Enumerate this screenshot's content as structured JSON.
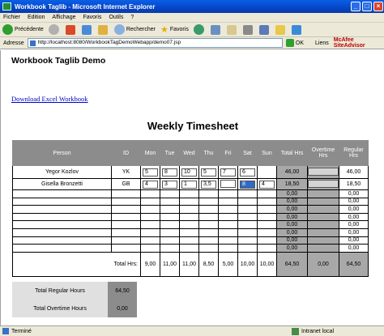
{
  "window": {
    "title": "Workbook Taglib - Microsoft Internet Explorer"
  },
  "menu": [
    "Fichier",
    "Edition",
    "Affichage",
    "Favoris",
    "Outils",
    "?"
  ],
  "toolbar": {
    "back": "Précédente",
    "search": "Rechercher",
    "favorites": "Favoris"
  },
  "address": {
    "label": "Adresse",
    "url": "http://localhost:8080/WorkbookTagDemoWebapp/demo07.jsp",
    "go": "OK",
    "links": "Liens",
    "addon": "McAfee SiteAdvisor"
  },
  "page": {
    "heading": "Workbook Taglib Demo",
    "download_link": "Download Excel Workbook",
    "sheet_title": "Weekly Timesheet"
  },
  "sheet": {
    "headers": [
      "Person",
      "ID",
      "Mon",
      "Tue",
      "Wed",
      "Thu",
      "Fri",
      "Sat",
      "Sun",
      "Total Hrs",
      "Overtime Hrs",
      "Regular Hrs"
    ],
    "rows": [
      {
        "person": "Yegor Kozlov",
        "id": "YK",
        "days": [
          "5",
          "8",
          "10",
          "5",
          "7",
          "6"
        ],
        "total": "46,00",
        "overtime": "",
        "regular": "46,00"
      },
      {
        "person": "Gisella Bronzetti",
        "id": "GB",
        "days": [
          "4",
          "3",
          "1",
          "3,5",
          "",
          "8",
          "4"
        ],
        "total": "18,50",
        "overtime": "",
        "regular": "18,50"
      }
    ],
    "empty_row_value": "0,00",
    "totals": {
      "label": "Total Hrs:",
      "values": [
        "9,00",
        "11,00",
        "11,00",
        "8,50",
        "5,00",
        "10,00",
        "10,00"
      ],
      "total": "64,50",
      "overtime": "0,00",
      "regular": "64,50"
    }
  },
  "summary": [
    {
      "label": "Total Regular Hours",
      "value": "64,50"
    },
    {
      "label": "Total Overtime Hours",
      "value": "0,00"
    }
  ],
  "status": {
    "left": "Terminé",
    "zone": "Intranet local"
  }
}
